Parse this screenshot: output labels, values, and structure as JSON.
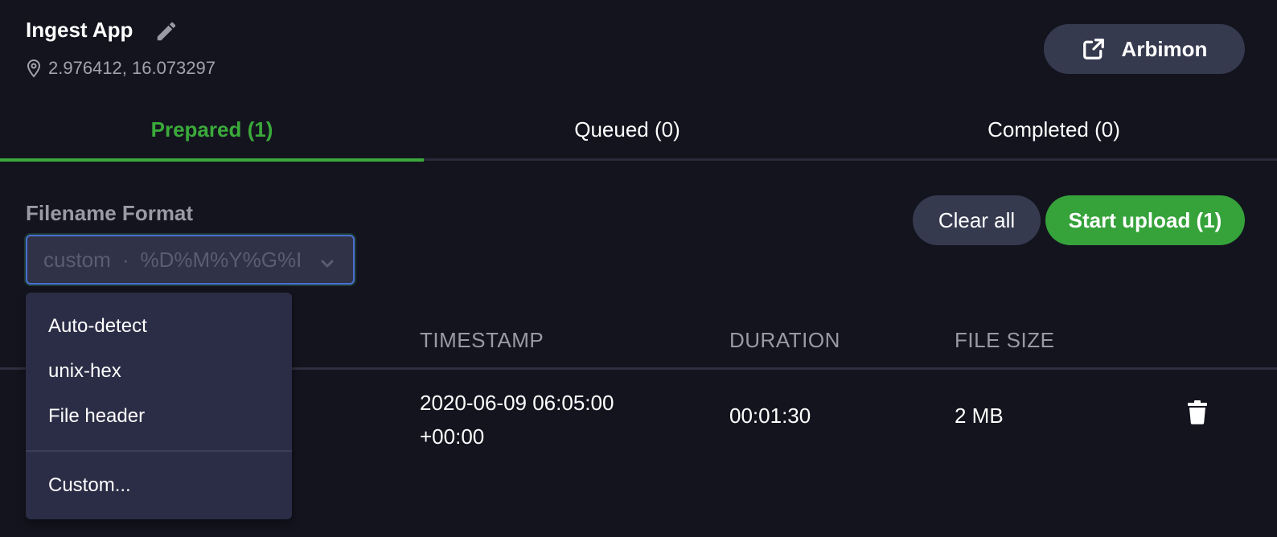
{
  "app": {
    "title": "Ingest App",
    "location": "2.976412, 16.073297"
  },
  "header": {
    "arbimon_label": "Arbimon"
  },
  "tabs": [
    {
      "label": "Prepared (1)",
      "active": true
    },
    {
      "label": "Queued (0)",
      "active": false
    },
    {
      "label": "Completed (0)",
      "active": false
    }
  ],
  "filename_format": {
    "label": "Filename Format",
    "selected_name": "custom",
    "separator": "·",
    "selected_pattern": "%D%M%Y%G%I",
    "options": [
      "Auto-detect",
      "unix-hex",
      "File header",
      "Custom..."
    ]
  },
  "actions": {
    "clear_label": "Clear all",
    "start_label": "Start upload (1)"
  },
  "table": {
    "columns": [
      "TIMESTAMP",
      "DURATION",
      "FILE SIZE"
    ],
    "rows": [
      {
        "timestamp": "2020-06-09 06:05:00 +00:00",
        "duration": "00:01:30",
        "file_size": "2 MB"
      }
    ]
  },
  "colors": {
    "background": "#14141f",
    "accent_green": "#35a23a",
    "button_gray": "#363a4f",
    "dropdown_bg": "#2b2c45",
    "focus_border": "#4a6fd2"
  },
  "icons": {
    "edit": "pencil-icon",
    "location": "map-pin-icon",
    "external": "external-link-icon",
    "chevron": "chevron-down-icon",
    "delete": "trash-icon"
  }
}
